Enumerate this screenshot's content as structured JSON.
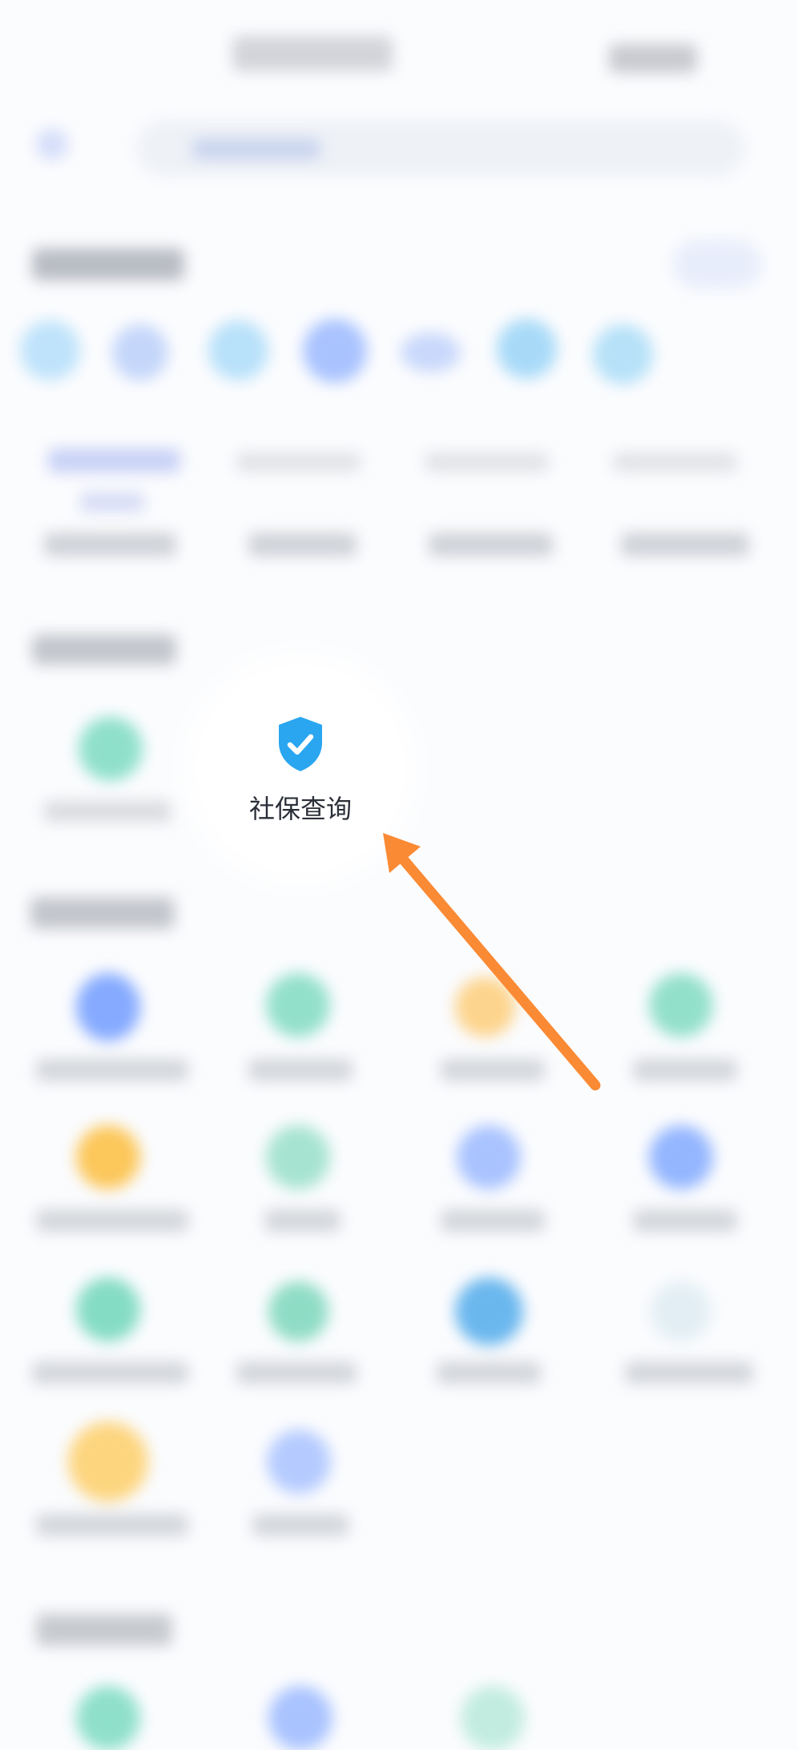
{
  "focus_item": {
    "label": "社保查询",
    "icon": "shield-check-icon",
    "icon_color": "#2aa6f0"
  },
  "annotation": {
    "type": "arrow",
    "color": "#fa8a34"
  },
  "colors": {
    "background": "#fbfcfe",
    "blue": "#6d9cff",
    "green": "#73d8c0",
    "orange": "#fbc24f",
    "skyblue": "#3ba7e9"
  }
}
